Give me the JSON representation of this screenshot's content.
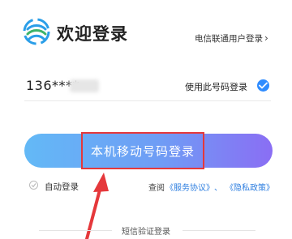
{
  "header": {
    "logo_icon": "china-mobile-logo-icon",
    "title": "欢迎登录",
    "alt_login_label": "电信联通用户登录",
    "alt_login_chevron": "›"
  },
  "account": {
    "phone_masked": "136****",
    "use_number_label": "使用此号码登录",
    "selected_icon": "check-circle-icon"
  },
  "primary_action": {
    "label": "本机移动号码登录",
    "highlight_color": "#e5383b",
    "gradient_colors": [
      "#63b9f6",
      "#8a6ef4"
    ]
  },
  "options": {
    "auto_login_label": "自动登录",
    "agreement_prefix": "查阅",
    "service_agreement": "《服务协议》",
    "separator": "、",
    "privacy_policy": "《隐私政策》"
  },
  "footer": {
    "sms_login_label": "短信验证登录"
  },
  "annotation": {
    "arrow_color": "#e5383b",
    "arrow_icon": "up-arrow-annotation-icon"
  }
}
